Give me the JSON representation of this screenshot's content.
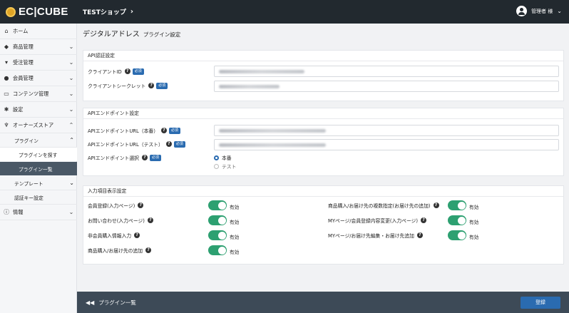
{
  "header": {
    "logo": "EC|CUBE",
    "shop": "TESTショップ",
    "user": "管理者 様"
  },
  "sidebar": {
    "home": "ホーム",
    "products": "商品管理",
    "orders": "受注管理",
    "customers": "会員管理",
    "content": "コンテンツ管理",
    "settings": "設定",
    "owners_store": "オーナーズストア",
    "plugin": "プラグイン",
    "plugin_search": "プラグインを探す",
    "plugin_list": "プラグイン一覧",
    "template": "テンプレート",
    "auth_key": "認証キー設定",
    "info": "情報"
  },
  "page": {
    "title": "デジタルアドレス",
    "subtitle": "プラグイン設定"
  },
  "api_auth": {
    "heading": "API認証設定",
    "client_id": "クライアントID",
    "client_secret": "クライアントシークレット"
  },
  "api_endpoint": {
    "heading": "APIエンドポイント設定",
    "url_prod": "APIエンドポイントURL（本番）",
    "url_test": "APIエンドポイントURL（テスト）",
    "select": "APIエンドポイント選択",
    "opt_prod": "本番",
    "opt_test": "テスト",
    "selected": "本番"
  },
  "display": {
    "heading": "入力項目表示設定",
    "items_left": [
      "会員登録(入力ページ)",
      "お問い合わせ(入力ページ)",
      "非会員購入情報入力",
      "商品購入/お届け先の追加"
    ],
    "items_right": [
      "商品購入/お届け先の複数指定(お届け先の追加)",
      "MYページ/会員登録内容変更(入力ページ)",
      "MYページ/お届け先編集・お届け先追加"
    ],
    "enabled_label": "有効"
  },
  "common": {
    "required": "必須",
    "help": "?"
  },
  "footer": {
    "back": "プラグイン一覧",
    "save": "登録"
  }
}
